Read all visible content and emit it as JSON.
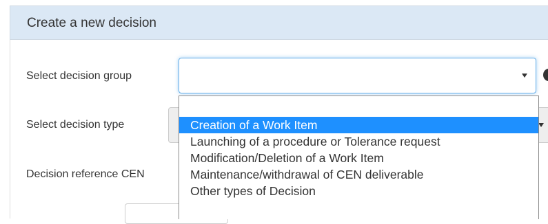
{
  "panel": {
    "title": "Create a new decision"
  },
  "form": {
    "decision_group_label": "Select decision group",
    "decision_type_label": "Select decision type",
    "decision_reference_label": "Decision reference CEN"
  },
  "dropdown": {
    "options": [
      "Creation of a Work Item",
      "Launching of a procedure or Tolerance request",
      "Modification/Deletion of a Work Item",
      "Maintenance/withdrawal of CEN deliverable",
      "Other types of Decision"
    ],
    "highlighted_index": 0
  },
  "colors": {
    "header_bg": "#dbe8f5",
    "highlight": "#1e90ff",
    "focus_border": "#66afe9"
  },
  "icons": [
    "caret-down-icon",
    "info-icon"
  ]
}
